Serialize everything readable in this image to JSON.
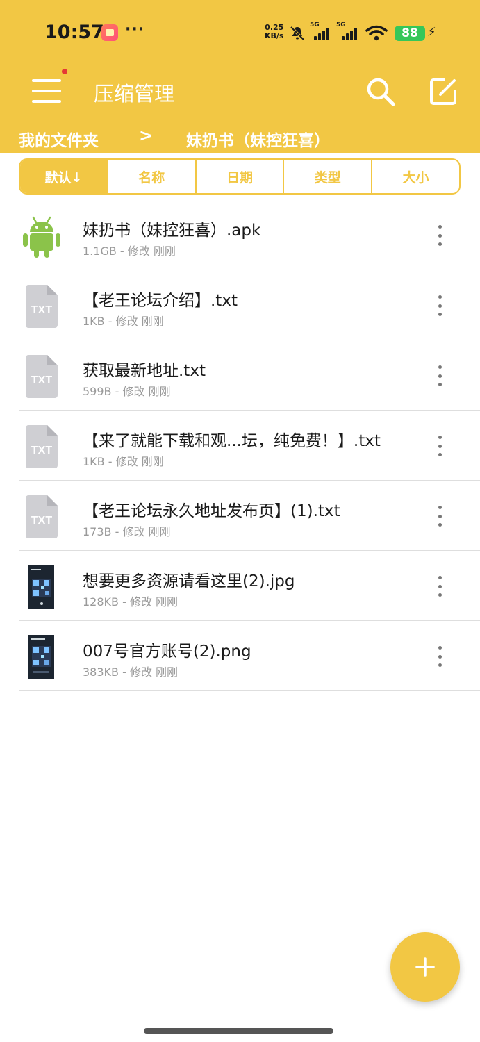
{
  "status_bar": {
    "time": "10:57",
    "more": "···",
    "net_speed_value": "0.25",
    "net_speed_unit": "KB/s",
    "signal1_label": "5G",
    "signal2_label": "5G",
    "battery": "88"
  },
  "app_bar": {
    "title": "压缩管理",
    "menu_icon": "menu-icon",
    "search_icon": "search-icon",
    "edit_icon": "edit-icon"
  },
  "breadcrumb": {
    "root": "我的文件夹",
    "separator": ">",
    "current": "妹扔书（妹控狂喜）"
  },
  "sort_tabs": [
    {
      "label": "默认↓",
      "active": true
    },
    {
      "label": "名称"
    },
    {
      "label": "日期"
    },
    {
      "label": "类型"
    },
    {
      "label": "大小"
    }
  ],
  "files": [
    {
      "name": "妹扔书（妹控狂喜）.apk",
      "meta": "1.1GB - 修改 刚刚",
      "icon": "android-icon"
    },
    {
      "name": "【老王论坛介绍】.txt",
      "meta": "1KB - 修改 刚刚",
      "icon": "txt-file-icon",
      "icon_text": "TXT"
    },
    {
      "name": "获取最新地址.txt",
      "meta": "599B - 修改 刚刚",
      "icon": "txt-file-icon",
      "icon_text": "TXT"
    },
    {
      "name": "【来了就能下载和观...坛，纯免费！】.txt",
      "meta": "1KB - 修改 刚刚",
      "icon": "txt-file-icon",
      "icon_text": "TXT"
    },
    {
      "name": "【老王论坛永久地址发布页】(1).txt",
      "meta": "173B - 修改 刚刚",
      "icon": "txt-file-icon",
      "icon_text": "TXT"
    },
    {
      "name": "想要更多资源请看这里(2).jpg",
      "meta": "128KB - 修改 刚刚",
      "icon": "image-thumbnail-icon"
    },
    {
      "name": "007号官方账号(2).png",
      "meta": "383KB - 修改 刚刚",
      "icon": "image-thumbnail-icon"
    }
  ],
  "fab": {
    "icon": "plus-icon"
  },
  "colors": {
    "accent": "#F2C744",
    "text": "#1a1a1a",
    "meta": "#9a9a9a"
  }
}
